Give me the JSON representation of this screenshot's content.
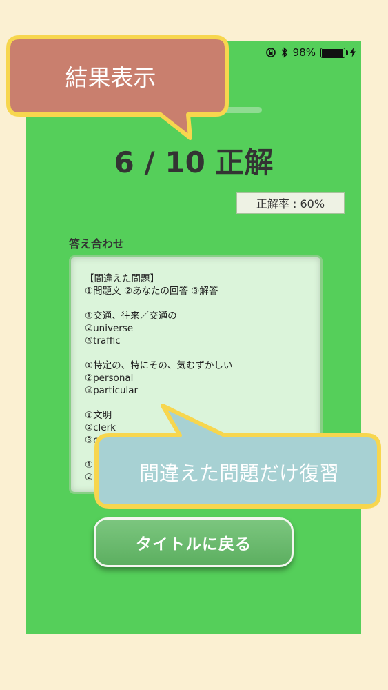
{
  "status_bar": {
    "battery_text": "98%",
    "battery_level": 0.98
  },
  "result": {
    "score_text": "6 / 10 正解",
    "accuracy_text": "正解率 : 60%"
  },
  "answers": {
    "heading": "答え合わせ",
    "lines": [
      "【間違えた問題】",
      "①問題文 ②あなたの回答 ③解答",
      "",
      "①交通、往来／交通の",
      "②universe",
      "③traffic",
      "",
      "①特定の、特にその、気むずかしい",
      "②personal",
      "③particular",
      "",
      "①文明",
      "②clerk",
      "③civi",
      "",
      "①",
      "②"
    ]
  },
  "buttons": {
    "back_to_title": "タイトルに戻る"
  },
  "callouts": {
    "top": "結果表示",
    "bottom": "間違えた問題だけ復習"
  },
  "colors": {
    "background": "#fbf0d2",
    "screen_green": "#55cf5a",
    "callout_top_fill": "#c97f6e",
    "callout_bottom_fill": "#a7d1d3",
    "callout_border": "#f7d64e"
  }
}
